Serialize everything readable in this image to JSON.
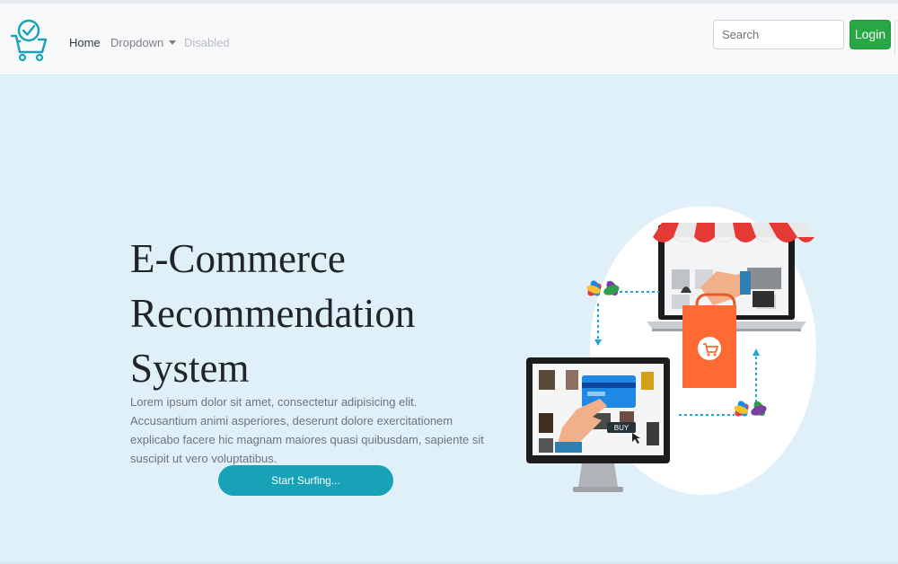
{
  "theme": {
    "hero_background": "#dff0f9",
    "navbar_background": "#f8f9fa",
    "login_color": "#28a745",
    "cta_color": "#17a2b8",
    "brand_color": "#17a2b8"
  },
  "navbar": {
    "brand_icon": "cart-check-icon",
    "links": [
      {
        "label": "Home",
        "state": "active"
      },
      {
        "label": "Dropdown",
        "state": "dropdown",
        "icon": "caret-down-icon"
      },
      {
        "label": "Disabled",
        "state": "disabled"
      }
    ],
    "search": {
      "placeholder": "Search",
      "value": ""
    },
    "login_label": "Login"
  },
  "hero": {
    "title_lines": [
      "E-Commerce",
      "Recommendation",
      "System"
    ],
    "description": "Lorem ipsum dolor sit amet, consectetur adipisicing elit. Accusantium animi asperiores, deserunt dolore exercitationem explicabo facere hic magnam maiores quasi quibusdam, sapiente sit suscipit ut vero voluptatibus.",
    "cta_label": "Start Surfing...",
    "illustration": {
      "icon": "online-shopping-illustration",
      "buy_label": "BUY"
    }
  }
}
